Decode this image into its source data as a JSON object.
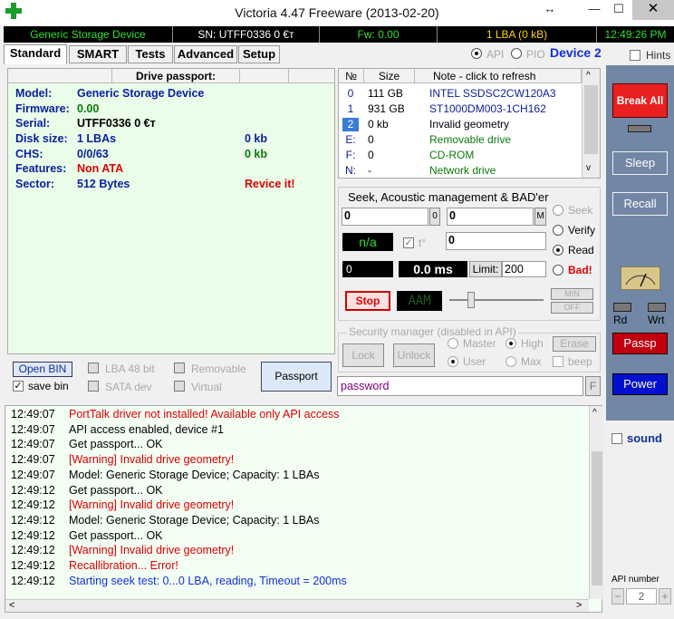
{
  "window": {
    "title": "Victoria 4.47  Freeware (2013-02-20)",
    "restore_glyph": "↔",
    "min_glyph": "—",
    "max_glyph": "☐",
    "close_glyph": "✕"
  },
  "status": {
    "device": "Generic Storage Device",
    "sn": "SN: UTFF0336   0   €т",
    "fw": "Fw: 0.00",
    "lba": "1 LBA (0 kB)",
    "time": "12:49:26 PM"
  },
  "tabs": [
    "Standard",
    "SMART",
    "Tests",
    "Advanced",
    "Setup"
  ],
  "api_pio": {
    "api": "API",
    "pio": "PIO",
    "device": "Device 2",
    "hints": "Hints"
  },
  "passport": {
    "header": "Drive passport:",
    "rows": [
      {
        "label": "Model:",
        "value": "Generic Storage Device",
        "extra": ""
      },
      {
        "label": "Firmware:",
        "value": "0.00",
        "extra": ""
      },
      {
        "label": "Serial:",
        "value": "UTFF0336   0   €т",
        "extra": ""
      },
      {
        "label": "Disk size:",
        "value": "1 LBAs",
        "extra": "0 kb"
      },
      {
        "label": "CHS:",
        "value": "0/0/63",
        "extra": "0 kb"
      },
      {
        "label": "Features:",
        "value": "Non ATA",
        "extra": ""
      },
      {
        "label": "Sector:",
        "value": "512 Bytes",
        "extra": "Revice it!"
      }
    ]
  },
  "drives": {
    "headers": [
      "№",
      "Size",
      "Note - click to refresh"
    ],
    "rows": [
      {
        "n": "0",
        "size": "111 GB",
        "note": "INTEL SSDSC2CW120A3"
      },
      {
        "n": "1",
        "size": "931 GB",
        "note": "ST1000DM003-1CH162"
      },
      {
        "n": "2",
        "size": "0 kb",
        "note": "Invalid geometry"
      },
      {
        "n": "E:",
        "size": "0",
        "note": "Removable drive"
      },
      {
        "n": "F:",
        "size": "0",
        "note": "CD-ROM"
      },
      {
        "n": "N:",
        "size": "-",
        "note": "Network drive"
      }
    ]
  },
  "seek": {
    "title": "Seek, Acoustic management & BAD'er",
    "from": "0",
    "to": "0",
    "from_btn": "0",
    "to_btn": "M",
    "na": "n/a",
    "t_label": "t°",
    "value3": "0",
    "counter": "0",
    "ms": "0.0 ms",
    "limit_label": "Limit:",
    "limit": "200",
    "radios": [
      "Seek",
      "Verify",
      "Read",
      "Bad!"
    ],
    "stop": "Stop",
    "aam": "AAM",
    "min": "MIN",
    "off": "OFF"
  },
  "security": {
    "title": "Security manager (disabled in API)",
    "lock": "Lock",
    "unlock": "Unlock",
    "master": "Master",
    "high": "High",
    "erase": "Erase",
    "user": "User",
    "max": "Max",
    "beep": "beep",
    "password": "password",
    "f": "F"
  },
  "bottom_left": {
    "open_bin": "Open BIN",
    "save_bin": "save bin",
    "lba48": "LBA 48 bit",
    "removable": "Removable",
    "sata": "SATA dev",
    "virtual": "Virtual",
    "passport_btn": "Passport"
  },
  "log": [
    {
      "t": "12:49:07",
      "msg": "PortTalk driver not installed! Available only API access",
      "c": "#e00000"
    },
    {
      "t": "12:49:07",
      "msg": "API access enabled, device #1",
      "c": "#000000"
    },
    {
      "t": "12:49:07",
      "msg": "Get passport... OK",
      "c": "#000000"
    },
    {
      "t": "12:49:07",
      "msg": "[Warning] Invalid drive geometry!",
      "c": "#e00000"
    },
    {
      "t": "12:49:07",
      "msg": "Model: Generic Storage Device; Capacity: 1 LBAs",
      "c": "#000000"
    },
    {
      "t": "12:49:12",
      "msg": "Get passport... OK",
      "c": "#000000"
    },
    {
      "t": "12:49:12",
      "msg": "[Warning] Invalid drive geometry!",
      "c": "#e00000"
    },
    {
      "t": "12:49:12",
      "msg": "Model: Generic Storage Device; Capacity: 1 LBAs",
      "c": "#000000"
    },
    {
      "t": "12:49:12",
      "msg": "Get passport... OK",
      "c": "#000000"
    },
    {
      "t": "12:49:12",
      "msg": "[Warning] Invalid drive geometry!",
      "c": "#e00000"
    },
    {
      "t": "12:49:12",
      "msg": "Recallibration... Error!",
      "c": "#e00000"
    },
    {
      "t": "12:49:12",
      "msg": "Starting seek test: 0...0 LBA, reading, Timeout = 200ms",
      "c": "#1030e0"
    }
  ],
  "right": {
    "break_all": "Break All",
    "sleep": "Sleep",
    "recall": "Recall",
    "rd": "Rd",
    "wrt": "Wrt",
    "passp": "Passp",
    "power": "Power",
    "sound": "sound",
    "api_number": "API number",
    "api_value": "2",
    "minus": "−",
    "plus": "+"
  }
}
